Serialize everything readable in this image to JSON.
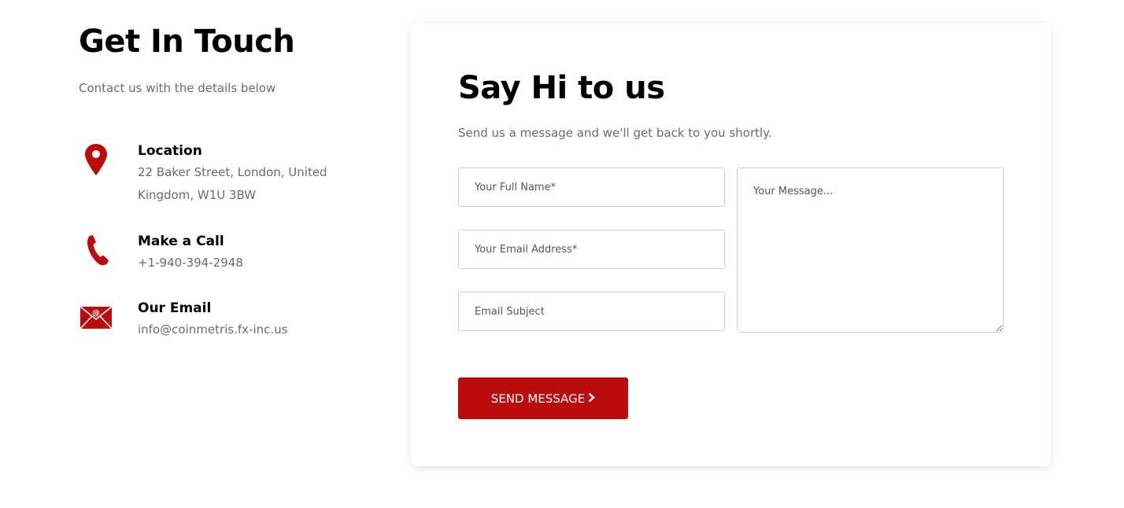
{
  "left": {
    "title": "Get In Touch",
    "subtitle": "Contact us with the details below",
    "items": [
      {
        "icon": "location-pin-icon",
        "title": "Location",
        "value_line1": "22 Baker Street, London, United",
        "value_line2": "Kingdom, W1U 3BW"
      },
      {
        "icon": "phone-icon",
        "title": "Make a Call",
        "value_line1": "+1-940-394-2948"
      },
      {
        "icon": "envelope-icon",
        "title": "Our Email",
        "value_line1": "info@coinmetris.fx-inc.us"
      }
    ]
  },
  "form": {
    "title": "Say Hi to us",
    "subtitle": "Send us a message and we'll get back to you shortly.",
    "name_placeholder": "Your Full Name*",
    "email_placeholder": "Your Email Address*",
    "subject_placeholder": "Email Subject",
    "message_placeholder": "Your Message...",
    "submit_label": "SEND MESSAGE",
    "submit_icon": "chevron-right-icon"
  },
  "colors": {
    "accent": "#bb0b0b",
    "muted_text": "#6b6b6b",
    "border": "#cfcfcf"
  }
}
